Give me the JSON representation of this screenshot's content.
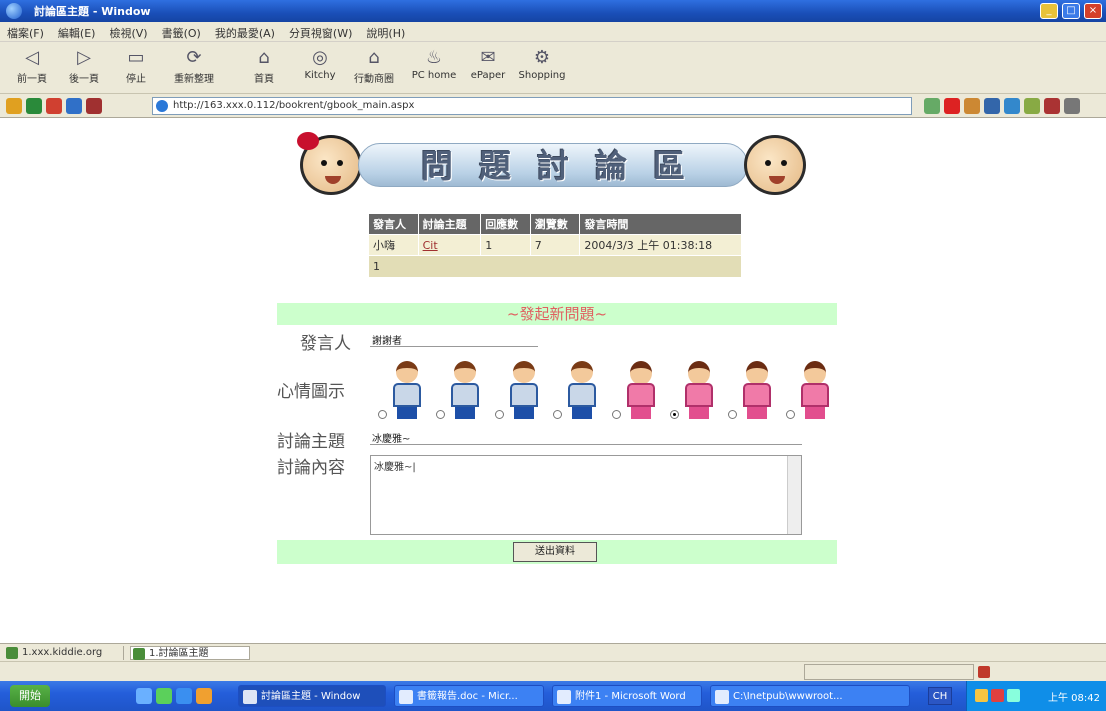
{
  "window": {
    "title": "討論區主題 - Window",
    "min": "_",
    "max": "□",
    "close": "×"
  },
  "menu": [
    "檔案(F)",
    "編輯(E)",
    "檢視(V)",
    "書籤(O)",
    "我的最愛(A)",
    "分頁視窗(W)",
    "說明(H)"
  ],
  "toolbar": [
    {
      "label": "前一頁",
      "icon": "back-icon"
    },
    {
      "label": "後一頁",
      "icon": "forward-icon"
    },
    {
      "label": "停止",
      "icon": "stop-icon"
    },
    {
      "label": "重新整理",
      "icon": "refresh-icon"
    },
    {
      "label": "首頁",
      "icon": "home-icon"
    },
    {
      "label": "Kitchy",
      "icon": "kitchy-icon"
    },
    {
      "label": "行動商圈",
      "icon": "mall-icon"
    },
    {
      "label": "PC home",
      "icon": "pchome-icon"
    },
    {
      "label": "ePaper",
      "icon": "epaper-icon"
    },
    {
      "label": "Shopping",
      "icon": "shopping-icon"
    }
  ],
  "address": {
    "url": "http://163.xxx.0.112/bookrent/gbook_main.aspx"
  },
  "banner": {
    "title": "問題討論區"
  },
  "posts": {
    "headers": [
      "發言人",
      "討論主題",
      "回應數",
      "瀏覽數",
      "發言時間"
    ],
    "rows": [
      {
        "author": "小嗨",
        "topic": "Cit",
        "replies": "1",
        "views": "7",
        "time": "2004/3/3 上午 01:38:18"
      }
    ],
    "pager": "1"
  },
  "form": {
    "heading": "~發起新問題~",
    "author_label": "發言人",
    "author_value": "謝謝者",
    "mood_label": "心情圖示",
    "moods": [
      "boy",
      "boy",
      "boy",
      "boy",
      "girl",
      "girl",
      "girl",
      "girl"
    ],
    "selected_mood": 5,
    "topic_label": "討論主題",
    "topic_value": "冰慶雅~",
    "content_label": "討論內容",
    "content_value": "冰慶雅~|",
    "submit_label": "送出資料"
  },
  "status": {
    "left": "1.xxx.kiddie.org",
    "right": "1.討論區主題"
  },
  "taskbar": {
    "start": "開始",
    "tasks": [
      "討論區主題 - Window",
      "書籤報告.doc - Micr...",
      "附件1 - Microsoft Word",
      "C:\\Inetpub\\wwwroot..."
    ],
    "lang": "CH",
    "clock": "上午 08:42"
  }
}
